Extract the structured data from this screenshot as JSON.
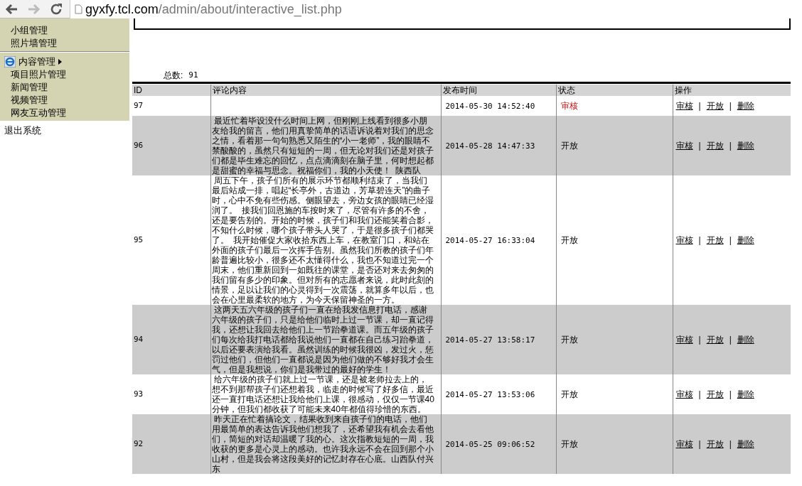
{
  "browser": {
    "url_host": "gyxfy.tcl.com",
    "url_path": "/admin/about/interactive_list.php"
  },
  "sidebar": {
    "top_items": [
      "小组管理",
      "照片墙管理"
    ],
    "section": {
      "title": "内容管理",
      "items": [
        "项目照片管理",
        "新闻管理",
        "视频管理",
        "网友互动管理"
      ]
    },
    "logout": "退出系统"
  },
  "summary": {
    "label": "总数:",
    "value": "91"
  },
  "table": {
    "columns": [
      "ID",
      "评论内容",
      "发布时间",
      "状态",
      "操作"
    ],
    "rows": [
      {
        "id": "97",
        "comment": "",
        "time": "2014-05-30 14:52:40",
        "status": {
          "text": "审核",
          "pending": true
        },
        "actions": [
          "审核",
          "|",
          "开放",
          "|",
          "删除"
        ]
      },
      {
        "id": "96",
        "comment": " 最近忙着毕设没什么时间上网，但刚刚上线看到很多小朋友给我的留言，他们用真挚简单的话语诉说着对我们的思念之情，看着那一句句熟悉又陌生的“小一老师”，我的眼睛不禁酸酸的，虽然只有短短的一周，但无论对我们还是对孩子们都是毕生难忘的回忆，点点滴滴刻在脑子里，何时想起都是甜蜜的幸福与思念。祝福你们，我的小天使！  陕西队",
        "time": "2014-05-28 14:47:33",
        "status": {
          "text": "开放",
          "pending": false
        },
        "actions": [
          "审核",
          "|",
          "开放",
          "|",
          "删除"
        ]
      },
      {
        "id": "95",
        "comment": " 周五下午，孩子们所有的展示环节都顺利结束了，当我们最后站成一排，唱起“长亭外，古道边，芳草碧连天”的曲子时，心中不免有些伤感。侧眼望去，旁边女孩的眼睛已经湿润了。  接我们回恩施的车按时来了，尽管有许多的不舍，还是要告别的。开始的时候，孩子们和我们还能笑着合影，不知什么时候，哪个孩子带头人哭了，于是很多孩子们都哭了。  我开始催促大家收拾东西上车，在教室门口，和站在外面的孩子们最后一次挥手告别。虽然我们所教的孩子们年龄普遍比较小，很多还不太懂得什么，我也不知道过完一个周末，他们重新回到一如既往的课堂，是否还对来去匆匆的我们留有多少的印象。但对所有的志愿者来说，此时此刻的情景，足以让我们的心灵得到一次震荡，就算多年以后，也会在心里最柔软的地方，为今天保留神圣的一方。",
        "time": "2014-05-27 16:33:04",
        "status": {
          "text": "开放",
          "pending": false
        },
        "actions": [
          "审核",
          "|",
          "开放",
          "|",
          "删除"
        ]
      },
      {
        "id": "94",
        "comment": " 这两天五六年级的孩子们一直在给我发信息打电话，感谢六年级的孩子们，只是给他们临时上过一节课，却一直记得我，还想让我回去给他们上一节跆拳道课。而五年级的孩子们每次给我打电话都给我说他们一直都在自己练习跆拳道，以后还要表演给我看。虽然训练的时候我很凶，发过火，惩罚过他们，但他们一直都说是因为他们做的不够好我才会生气，但是我想说，你们是我带过的最好的学生！",
        "time": "2014-05-27 13:58:17",
        "status": {
          "text": "开放",
          "pending": false
        },
        "actions": [
          "审核",
          "|",
          "开放",
          "|",
          "删除"
        ]
      },
      {
        "id": "93",
        "comment": " 给六年级的孩子们就上过一节课，还是被老师拉去上的，想不到那帮孩子们还想着我，临走的时候写了好多信，最近还一直打电话还想让我给他们上课，很感动，仅仅一节课40分钟，但我们都收获了可能未来40年都值得珍惜的东西。",
        "time": "2014-05-27 13:53:06",
        "status": {
          "text": "开放",
          "pending": false
        },
        "actions": [
          "审核",
          "|",
          "开放",
          "|",
          "删除"
        ]
      },
      {
        "id": "92",
        "comment": " 昨天正在忙着搞论文，结果收到来自孩子们的电话，他们用最简单的表达告诉我他们想我了，还希望我有机会去看他们，简短的对话却温暖了我的心。这次指教短短的一周，我收获的更多是心灵上的感动。也许我永远不会在回到那个小山村，但是我会将这段美好的记忆封存在心底。山西队付兴东",
        "time": "2014-05-25 09:06:52",
        "status": {
          "text": "开放",
          "pending": false
        },
        "actions": [
          "审核",
          "|",
          "开放",
          "|",
          "删除"
        ]
      }
    ]
  }
}
